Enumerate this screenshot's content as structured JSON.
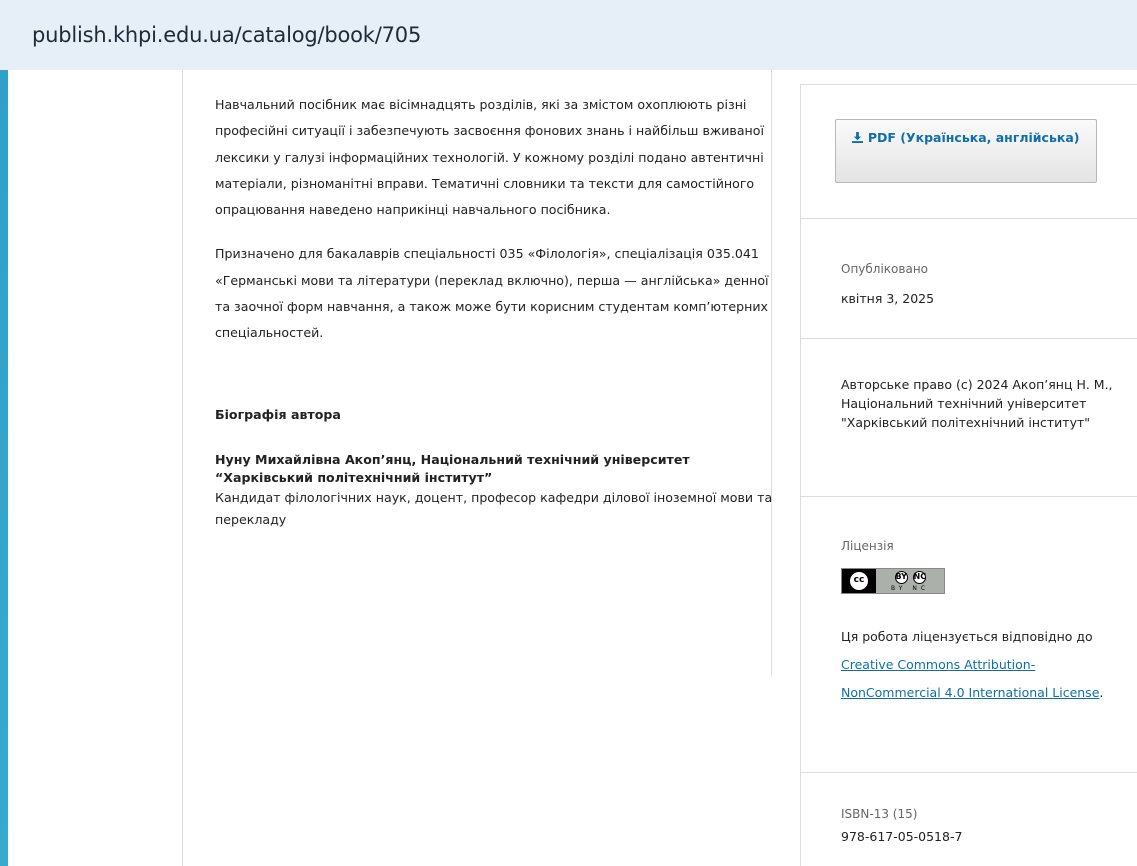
{
  "browser": {
    "url": "publish.khpi.edu.ua/catalog/book/705"
  },
  "main": {
    "paragraphs": [
      "Навчальний посібник має вісімнадцять розділів, які за змістом охоплюють різні професійні ситуації і забезпечують засвоєння фонових знань і найбільш вживаної лексики у галузі інформаційних технологій. У кожному розділі подано автентичні матеріали, різноманітні вправи. Тематичні словники та тексти для самостійного опрацювання наведено наприкінці навчального посібника.",
      "Призначено для бакалаврів спеціальності 035 «Філологія», спеціалізація 035.041 «Германські мови та літератури  (переклад включно), перша — англійська» денної та заочної форм навчання, а також може бути корисним студентам комп’ютерних спеціальностей."
    ],
    "bio_heading": "Біографія автора",
    "bio_name": "Нуну Михайлівна Акоп’янц, Національний технічний університет “Харківський політехнічний інститут”",
    "bio_desc": "Кандидат філологічних наук, доцент, професор кафедри ділової іноземної мови та перекладу"
  },
  "sidebar": {
    "pdf_button": "PDF (Українська, англійська)",
    "pdf_icon": "download-icon",
    "published_label": "Опубліковано",
    "published_date": "квітня 3, 2025",
    "copyright": "Авторське право (c) 2024 Акоп’янц Н. М., Національний технічний університет \"Харківський політехнічний інститут\"",
    "license_label": "Ліцензія",
    "license_badge": {
      "left": "cc",
      "icons": [
        "BY",
        "NC"
      ],
      "sub": "BY  NC"
    },
    "license_text_before": "Ця робота ліцензується відповідно до ",
    "license_link": "Creative Commons Attribution-NonCommercial 4.0 International License",
    "license_text_after": ".",
    "isbn_label": "ISBN-13 (15)",
    "isbn_value": "978-617-05-0518-7"
  }
}
